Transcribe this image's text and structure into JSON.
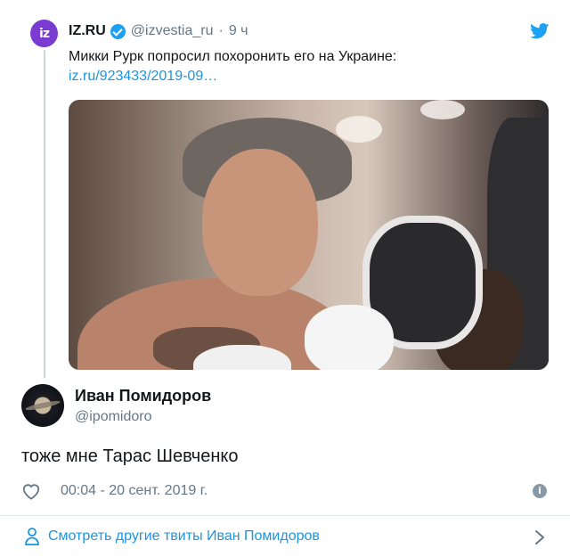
{
  "quoted_tweet": {
    "avatar_text": "iz",
    "name": "IZ.RU",
    "handle": "@izvestia_ru",
    "separator": "·",
    "time": "9 ч",
    "text": "Микки Рурк попросил похоронить его на Украине:",
    "link": "iz.ru/923433/2019-09…",
    "icons": {
      "verified": "verified-badge-icon",
      "brand": "twitter-bird-icon"
    }
  },
  "reply_tweet": {
    "name": "Иван Помидоров",
    "handle": "@ipomidoro",
    "text": "тоже мне Тарас Шевченко",
    "timestamp": "00:04 - 20 сент. 2019 г.",
    "icons": {
      "like": "heart-icon",
      "info": "info-icon"
    }
  },
  "footer": {
    "more_tweets_label": "Смотреть другие твиты Иван Помидоров",
    "icons": {
      "person": "person-icon",
      "chevron": "chevron-right-icon"
    }
  },
  "colors": {
    "link_blue": "#1b95e0",
    "twitter_blue": "#1da1f2",
    "secondary_text": "#657786",
    "izru_purple": "#7a3bd1"
  }
}
